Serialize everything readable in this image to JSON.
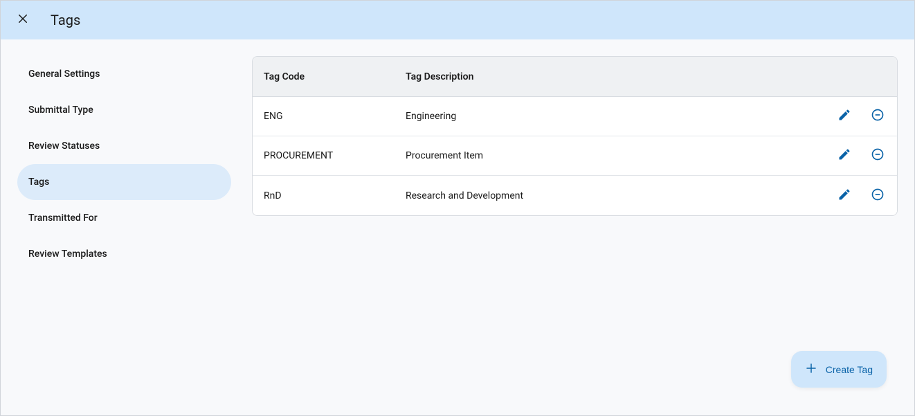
{
  "header": {
    "title": "Tags"
  },
  "sidebar": {
    "items": [
      {
        "label": "General Settings",
        "active": false
      },
      {
        "label": "Submittal Type",
        "active": false
      },
      {
        "label": "Review Statuses",
        "active": false
      },
      {
        "label": "Tags",
        "active": true
      },
      {
        "label": "Transmitted For",
        "active": false
      },
      {
        "label": "Review Templates",
        "active": false
      }
    ]
  },
  "table": {
    "headers": {
      "code": "Tag Code",
      "description": "Tag Description"
    },
    "rows": [
      {
        "code": "ENG",
        "description": "Engineering"
      },
      {
        "code": "PROCUREMENT",
        "description": "Procurement Item"
      },
      {
        "code": "RnD",
        "description": "Research and Development"
      }
    ]
  },
  "actions": {
    "create_label": "Create Tag"
  }
}
